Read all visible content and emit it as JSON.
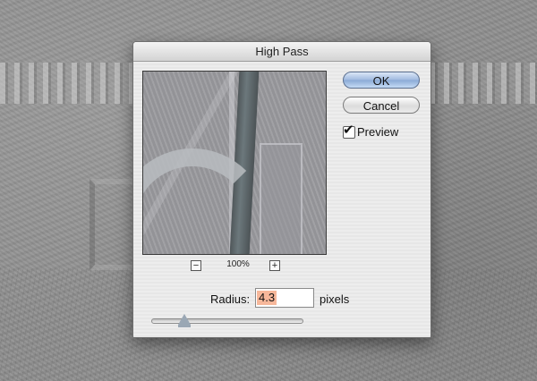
{
  "dialog": {
    "title": "High Pass",
    "ok_label": "OK",
    "cancel_label": "Cancel",
    "preview_checkbox": {
      "label": "Preview",
      "checked": true
    },
    "zoom": {
      "level": "100%",
      "minus_icon": "minus-icon",
      "plus_icon": "plus-icon"
    },
    "radius": {
      "label": "Radius:",
      "value": "4.3",
      "unit": "pixels",
      "slider_fraction": 0.22
    }
  },
  "colors": {
    "ok_button": "#9fb9df",
    "field_selection": "#f6b79a",
    "dialog_background": "#ececec"
  }
}
